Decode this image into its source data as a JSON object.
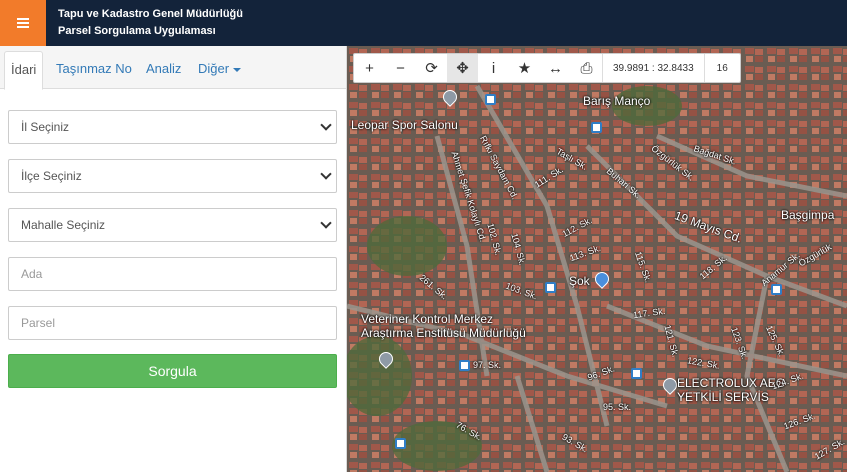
{
  "header": {
    "title_line1": "Tapu ve Kadastro Genel Müdürlüğü",
    "title_line2": "Parsel Sorgulama Uygulaması",
    "menu_icon": "hamburger-icon"
  },
  "tabs": [
    {
      "label": "İdari",
      "active": true
    },
    {
      "label": "Taşınmaz No"
    },
    {
      "label": "Analiz"
    },
    {
      "label": "Diğer"
    }
  ],
  "form": {
    "il_select": "İl Seçiniz",
    "ilce_select": "İlçe Seçiniz",
    "mahalle_select": "Mahalle Seçiniz",
    "ada_placeholder": "Ada",
    "parsel_placeholder": "Parsel",
    "submit_label": "Sorgula"
  },
  "map_toolbar": {
    "coordinates": "39.9891 : 32.8433",
    "zoom": "16",
    "tools": [
      "zoom-in-icon",
      "zoom-out-icon",
      "refresh-icon",
      "pan-icon",
      "info-icon",
      "star-icon",
      "measure-icon",
      "print-icon"
    ]
  },
  "map_labels": {
    "baris_manco": "Barış Manço",
    "leopar": "Leopar Spor Salonu",
    "rifki_saydam": "Rıfkı Saydam Cd.",
    "ahmet": "Ahmet Şefik Kolaylı Cd.",
    "bagdat": "Bağdat Sk.",
    "ozgurluk1": "Özgürlük Sk.",
    "ozgurluk2": "Özgürlük",
    "basgimpa": "Başgimpa",
    "mayis": "19 Mayıs Cd.",
    "anamur": "Anamur Sk.",
    "sok": "Şok",
    "veteriner1": "Veteriner Kontrol Merkez",
    "veteriner2": "Araştırma Enstitüsü Müdürlüğü",
    "electrolux1": "ELECTROLUX AEG",
    "electrolux2": "YETKİLİ SERVİS",
    "s111": "111. Sk.",
    "s112": "112. Sk.",
    "s113": "113. Sk.",
    "s115": "115. Sk.",
    "s117": "117. Sk.",
    "s118": "118. Sk.",
    "s121": "121. Sk.",
    "s122": "122. Sk.",
    "s123": "123. Sk.",
    "s124": "124. Sk.",
    "s125": "125. Sk.",
    "s126": "126. Sk.",
    "s127": "127. Sk.",
    "s93": "93. Sk.",
    "s95": "95. Sk.",
    "s96": "96. Sk.",
    "s97": "97. Sk.",
    "s76": "76. Sk.",
    "s102": "102. Sk.",
    "s103": "103. Sk.",
    "s104": "104. Sk.",
    "s261": "261. Sk.",
    "tasli": "Taşlı Sk.",
    "buhari": "Buhari Sk."
  }
}
